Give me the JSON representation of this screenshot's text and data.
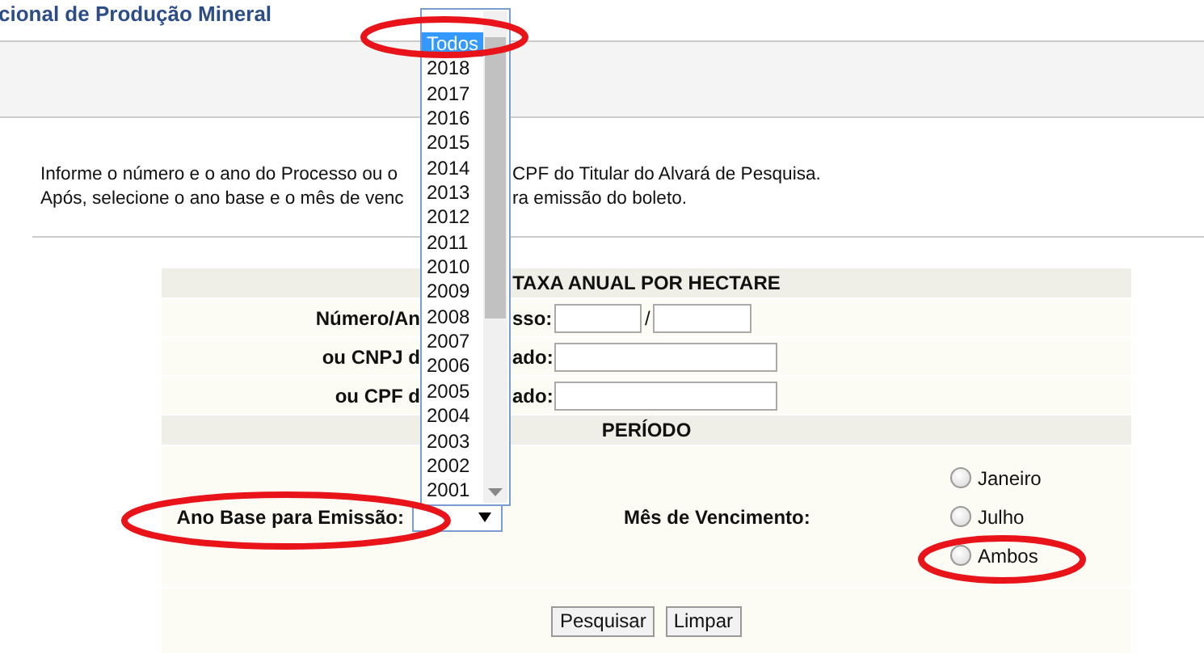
{
  "header": {
    "title": "cional de Produção Mineral"
  },
  "instructions": [
    {
      "before": "Informe o número e o ano do Processo ou o",
      "after": "CPF do Titular do Alvará de Pesquisa."
    },
    {
      "before": "Após, selecione o ano base e o mês de venc",
      "after": "ra emissão do boleto."
    }
  ],
  "form": {
    "title": "TAXA ANUAL POR HECTARE",
    "fields": [
      {
        "kind": "pair",
        "label": "Número/An",
        "label_end": "sso:",
        "separator": "/"
      },
      {
        "kind": "single",
        "label": "ou CNPJ d",
        "label_end": "ado:"
      },
      {
        "kind": "single",
        "label": "ou CPF d",
        "label_end": "ado:"
      }
    ],
    "period": {
      "title": "PERÍODO",
      "year_label": "Ano Base para Emissão:",
      "year_select": {
        "expanded": true,
        "options": [
          {
            "label": "Todos",
            "selected": true
          },
          {
            "label": "2018",
            "selected": false
          },
          {
            "label": "2017",
            "selected": false
          },
          {
            "label": "2016",
            "selected": false
          },
          {
            "label": "2015",
            "selected": false
          },
          {
            "label": "2014",
            "selected": false
          },
          {
            "label": "2013",
            "selected": false
          },
          {
            "label": "2012",
            "selected": false
          },
          {
            "label": "2011",
            "selected": false
          },
          {
            "label": "2010",
            "selected": false
          },
          {
            "label": "2009",
            "selected": false
          },
          {
            "label": "2008",
            "selected": false
          },
          {
            "label": "2007",
            "selected": false
          },
          {
            "label": "2006",
            "selected": false
          },
          {
            "label": "2005",
            "selected": false
          },
          {
            "label": "2004",
            "selected": false
          },
          {
            "label": "2003",
            "selected": false
          },
          {
            "label": "2002",
            "selected": false
          },
          {
            "label": "2001",
            "selected": false
          }
        ]
      },
      "month_label": "Mês de Vencimento:",
      "months": [
        {
          "label": "Janeiro",
          "selected": false
        },
        {
          "label": "Julho",
          "selected": false
        },
        {
          "label": "Ambos",
          "selected": false
        }
      ]
    },
    "buttons": [
      "Pesquisar",
      "Limpar"
    ]
  }
}
